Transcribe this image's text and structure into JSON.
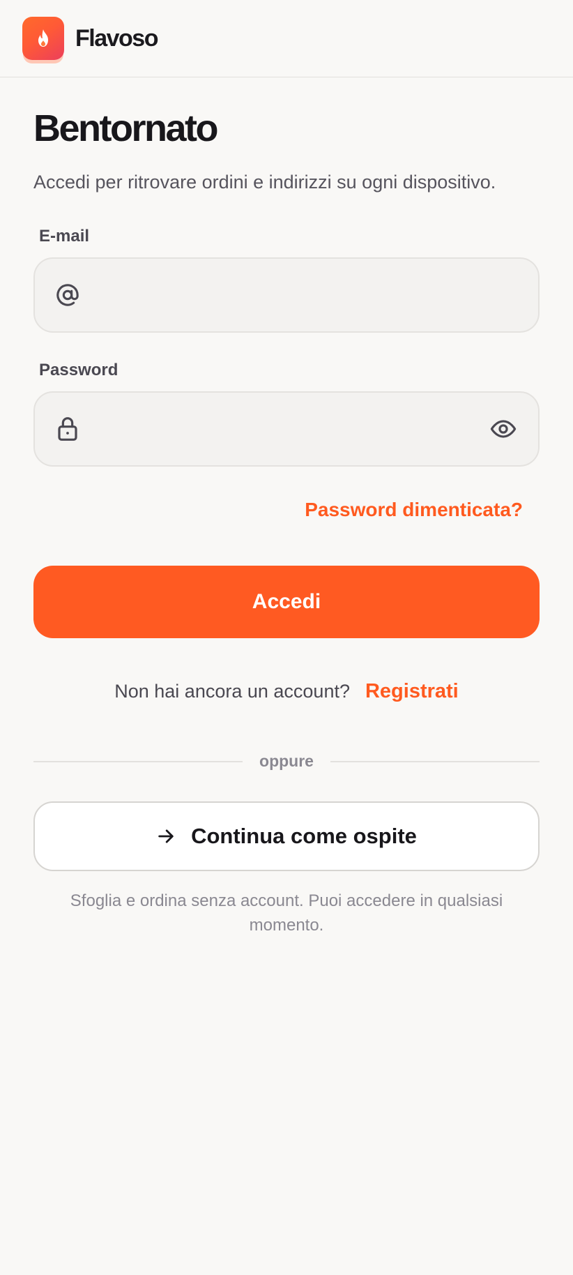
{
  "app": {
    "name": "Flavoso"
  },
  "login": {
    "title": "Bentornato",
    "subtitle": "Accedi per ritrovare ordini e indirizzi su ogni dispositivo.",
    "email_label": "E-mail",
    "email_value": "",
    "password_label": "Password",
    "password_value": "",
    "forgot_label": "Password dimenticata?",
    "submit_label": "Accedi",
    "signup_prompt": "Non hai ancora un account?",
    "signup_link": "Registrati",
    "divider_label": "oppure",
    "guest_label": "Continua come ospite",
    "guest_note": "Sfoglia e ordina senza account. Puoi accedere in qualsiasi momento."
  },
  "icons": {
    "logo": "flame-icon",
    "email": "at-sign-icon",
    "password": "lock-icon",
    "reveal": "eye-icon",
    "guest": "arrow-right-icon"
  },
  "colors": {
    "accent": "#ff5a22",
    "background": "#f9f8f6",
    "field": "#f3f2f0"
  }
}
